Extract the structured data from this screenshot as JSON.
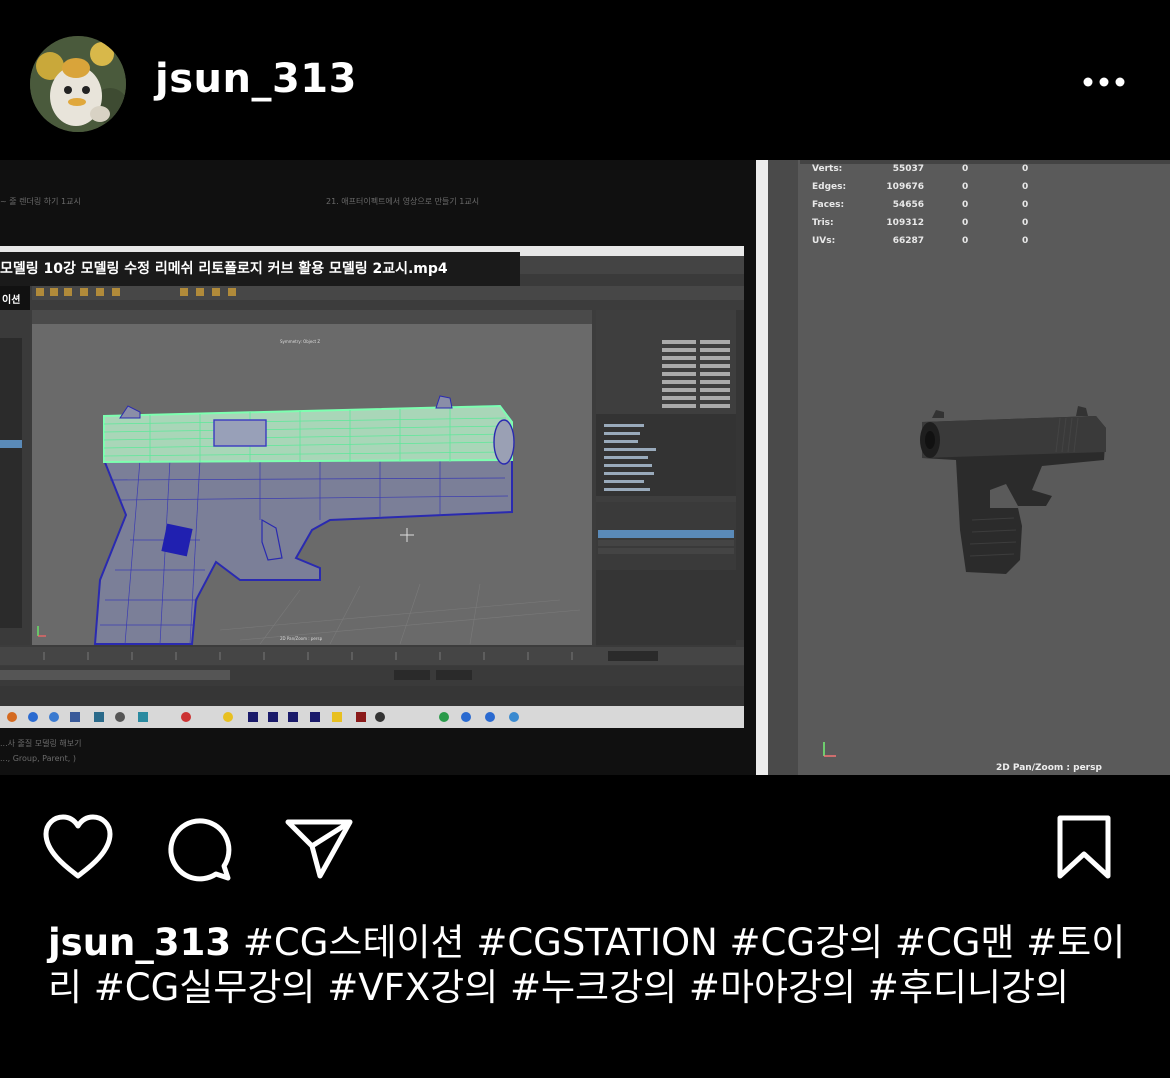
{
  "post": {
    "username": "jsun_313",
    "caption_hashtags": "#CG스테이션 #CGSTATION #CG강의 #CG맨 #토이리 #CG실무강의 #VFX강의 #누크강의 #마야강의 #후디니강의"
  },
  "media": {
    "video_title": "모델링 10강 모델링 수정 리메쉬 리토폴로지 커브 활용 모델링 2교시.mp4",
    "top_left_text": "~ 줄 렌더링 하기 1교시",
    "top_mid_text": "21. 애프터이펙트에서 영상으로 만들기 1교시",
    "bottom_left_line1": "...사 줄질 모델링 해보기",
    "bottom_left_line2": "..., Group, Parent, )",
    "left_tab_label": "이션",
    "viewport_caption": "2D Pan/Zoom : persp",
    "stats": [
      {
        "label": "Verts:",
        "v1": "55037",
        "v2": "0",
        "v3": "0"
      },
      {
        "label": "Edges:",
        "v1": "109676",
        "v2": "0",
        "v3": "0"
      },
      {
        "label": "Faces:",
        "v1": "54656",
        "v2": "0",
        "v3": "0"
      },
      {
        "label": "Tris:",
        "v1": "109312",
        "v2": "0",
        "v3": "0"
      },
      {
        "label": "UVs:",
        "v1": "66287",
        "v2": "0",
        "v3": "0"
      }
    ]
  },
  "colors": {
    "background": "#000000",
    "maya_gray": "#5a5a5a",
    "wire_green": "#7dffb0",
    "wire_blue": "#2b2bd0"
  }
}
